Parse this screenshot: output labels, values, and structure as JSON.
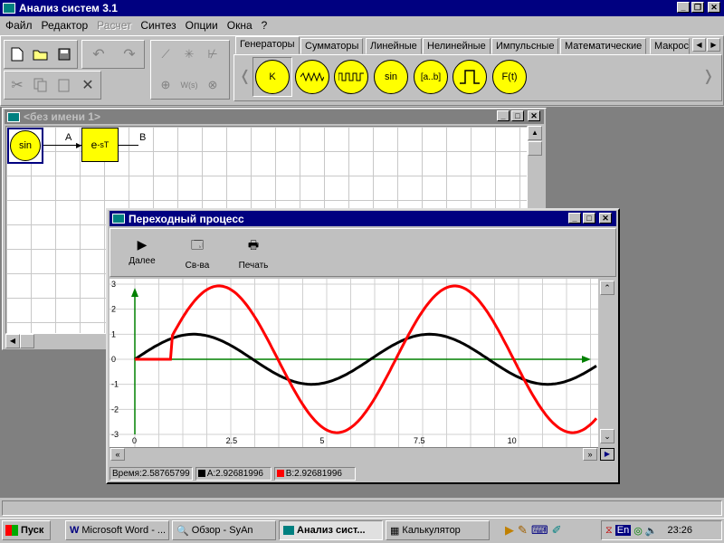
{
  "app": {
    "title": "Анализ систем 3.1"
  },
  "menu": [
    "Файл",
    "Редактор",
    "Расчет",
    "Синтез",
    "Опции",
    "Окна",
    "?"
  ],
  "palette_tabs": [
    "Генераторы",
    "Сумматоры",
    "Линейные",
    "Нелинейные",
    "Импульсные",
    "Математические",
    "Макрос"
  ],
  "generators": [
    "K",
    "~",
    "⊓⊓",
    "sin",
    "[a..b]",
    "⊓",
    "F(t)"
  ],
  "schema_window": {
    "title": "<без имени 1>",
    "block1": "sin",
    "block2_base": "e",
    "block2_sup": "-sT",
    "link_a": "A",
    "link_b": "B"
  },
  "plot_window": {
    "title": "Переходный процесс",
    "toolbar": {
      "next": "Далее",
      "props": "Св-ва",
      "print": "Печать"
    },
    "status": {
      "time": "Время:2.58765799",
      "a": "A:2.92681996",
      "b": "B:2.92681996"
    }
  },
  "chart_data": {
    "type": "line",
    "xlim": [
      0,
      12.3
    ],
    "ylim": [
      -3,
      3
    ],
    "x_ticks": [
      "0",
      "2.5",
      "5",
      "7.5",
      "10"
    ],
    "x_tick_values": [
      0,
      2.5,
      5,
      7.5,
      10
    ],
    "y_ticks": [
      "3",
      "2",
      "1",
      "0",
      "-1",
      "-2",
      "-3"
    ],
    "y_tick_values": [
      3,
      2,
      1,
      0,
      -1,
      -2,
      -3
    ],
    "grid": true,
    "series": [
      {
        "name": "A",
        "color": "#000000",
        "kind": "sin",
        "amplitude": 1,
        "delay": 0
      },
      {
        "name": "B",
        "color": "#ff0000",
        "kind": "delayed-sin",
        "amplitude": 2.93,
        "delay": 1
      }
    ]
  },
  "taskbar": {
    "start": "Пуск",
    "tasks": [
      "Microsoft Word - ...",
      "Обзор - SyAn",
      "Анализ сист...",
      "Калькулятор"
    ],
    "tray_lang": "En",
    "clock": "23:26"
  },
  "colors": {
    "desktop": "#808080",
    "title_active": "#000080",
    "block": "#ffff00"
  }
}
